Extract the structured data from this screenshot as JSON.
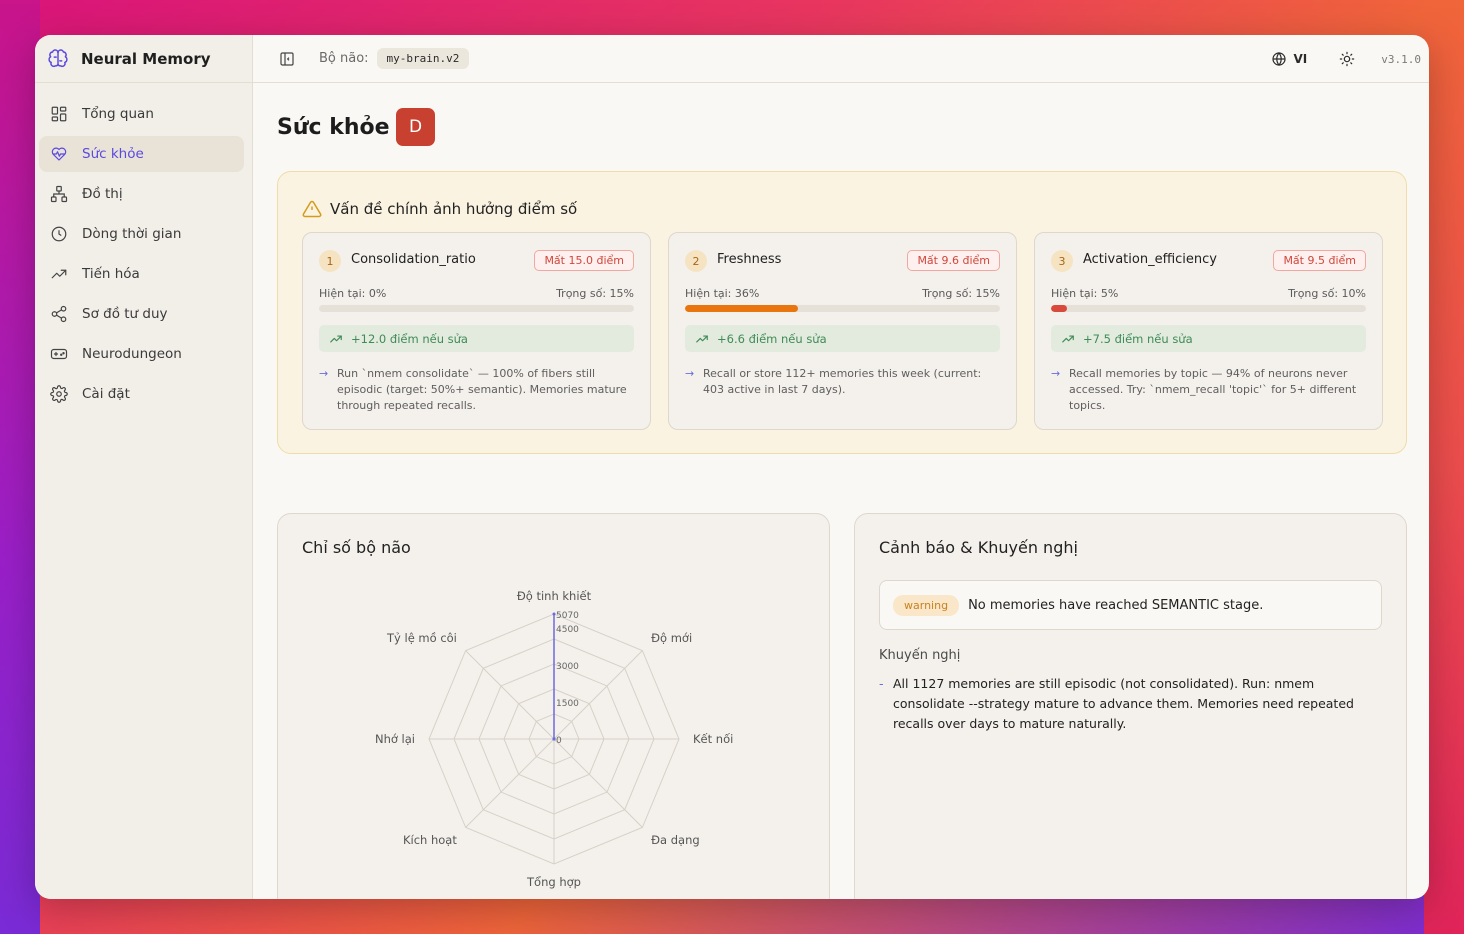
{
  "app": {
    "title": "Neural Memory",
    "version": "v3.1.0"
  },
  "topbar": {
    "brain_label": "Bộ não:",
    "brain_name": "my-brain.v2",
    "lang": "VI"
  },
  "sidebar": {
    "items": [
      {
        "label": "Tổng quan",
        "icon": "dashboard-icon"
      },
      {
        "label": "Sức khỏe",
        "icon": "heart-pulse-icon",
        "active": true
      },
      {
        "label": "Đồ thị",
        "icon": "graph-icon"
      },
      {
        "label": "Dòng thời gian",
        "icon": "clock-icon"
      },
      {
        "label": "Tiến hóa",
        "icon": "trending-icon"
      },
      {
        "label": "Sơ đồ tư duy",
        "icon": "share-icon"
      },
      {
        "label": "Neurodungeon",
        "icon": "gamepad-icon"
      },
      {
        "label": "Cài đặt",
        "icon": "gear-icon"
      }
    ]
  },
  "page": {
    "title": "Sức khỏe",
    "grade": "D"
  },
  "issues": {
    "title": "Vấn đề chính ảnh hưởng điểm số",
    "cards": [
      {
        "num": "1",
        "name": "Consolidation_ratio",
        "loss": "Mất 15.0 điểm",
        "current": "Hiện tại: 0%",
        "weight": "Trọng số: 15%",
        "level": 0,
        "bar_color": "#e6e1d8",
        "gain": "+12.0 điểm nếu sửa",
        "tip": "Run `nmem consolidate` — 100% of fibers still episodic (target: 50%+ semantic). Memories mature through repeated recalls."
      },
      {
        "num": "2",
        "name": "Freshness",
        "loss": "Mất 9.6 điểm",
        "current": "Hiện tại: 36%",
        "weight": "Trọng số: 15%",
        "level": 0.36,
        "bar_color": "#e8750e",
        "gain": "+6.6 điểm nếu sửa",
        "tip": "Recall or store 112+ memories this week (current: 403 active in last 7 days)."
      },
      {
        "num": "3",
        "name": "Activation_efficiency",
        "loss": "Mất 9.5 điểm",
        "current": "Hiện tại: 5%",
        "weight": "Trọng số: 10%",
        "level": 0.05,
        "bar_color": "#d94a3d",
        "gain": "+7.5 điểm nếu sửa",
        "tip": "Recall memories by topic — 94% of neurons never accessed. Try: `nmem_recall 'topic'` for 5+ different topics."
      }
    ]
  },
  "brain_index": {
    "title": "Chỉ số bộ não"
  },
  "chart_data": {
    "type": "radar",
    "categories": [
      "Độ tinh khiết",
      "Độ mới",
      "Kết nối",
      "Đa dạng",
      "Tổng hợp",
      "Kích hoạt",
      "Nhớ lại",
      "Tỷ lệ mồ côi"
    ],
    "ticks": [
      "0",
      "1500",
      "3000",
      "4500",
      "5070"
    ],
    "range": [
      0,
      5070
    ],
    "values": [
      5070,
      0,
      0,
      0,
      0,
      0,
      0,
      0
    ],
    "series_color": "#6b6bdd",
    "grid": true
  },
  "warnings": {
    "title": "Cảnh báo & Khuyến nghị",
    "alert_badge": "warning",
    "alert_text": "No memories have reached SEMANTIC stage.",
    "rec_title": "Khuyến nghị",
    "rec_dash": "-",
    "rec_text": "All 1127 memories are still episodic (not consolidated). Run: nmem consolidate --strategy mature to advance them. Memories need repeated recalls over days to mature naturally."
  }
}
